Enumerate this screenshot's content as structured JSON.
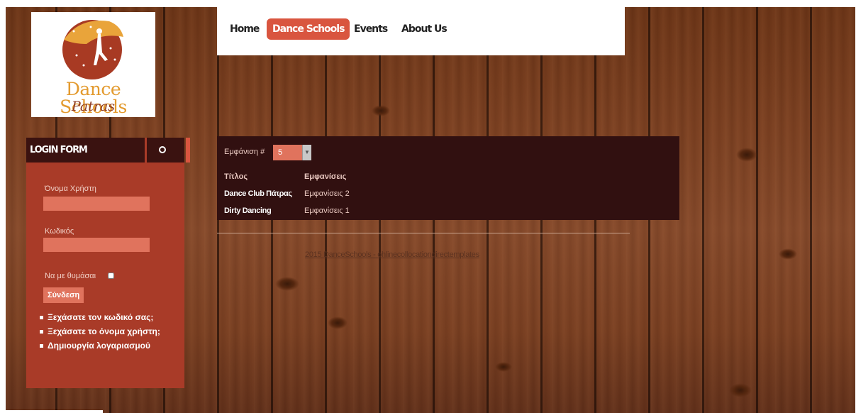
{
  "logo": {
    "line1": "Dance Schools",
    "line2": "Patras"
  },
  "nav": {
    "items": [
      {
        "label": "Home",
        "active": false
      },
      {
        "label": "Dance Schools",
        "active": true
      },
      {
        "label": "Events",
        "active": false
      },
      {
        "label": "About Us",
        "active": false
      }
    ]
  },
  "login": {
    "title": "LOGIN FORM",
    "settings_icon": "gear-icon",
    "username_label": "Όνομα Χρήστη",
    "username_value": "",
    "password_label": "Κωδικός",
    "password_value": "",
    "remember_label": "Να με θυμάσαι",
    "submit_label": "Σύνδεση",
    "links": [
      "Ξεχάσατε τον κωδικό σας;",
      "Ξεχάσατε το όνομα χρήστη;",
      "Δημιουργία λογαριασμού"
    ]
  },
  "results": {
    "display_label": "Εμφάνιση #",
    "display_value": "5",
    "columns": [
      "Τίτλος",
      "Εμφανίσεις"
    ],
    "rows": [
      {
        "title": "Dance Club Πάτρας",
        "hits": "Εμφανίσεις 2"
      },
      {
        "title": "Dirty Dancing",
        "hits": "Εμφανίσεις 1"
      }
    ]
  },
  "footer": {
    "text": "2015 DanceSchools - ohlinecollocationdirectemplates"
  },
  "colors": {
    "accent": "#d9553f",
    "panel": "#311010",
    "login_bg": "#a93b28",
    "field_bg": "#e0735d"
  }
}
